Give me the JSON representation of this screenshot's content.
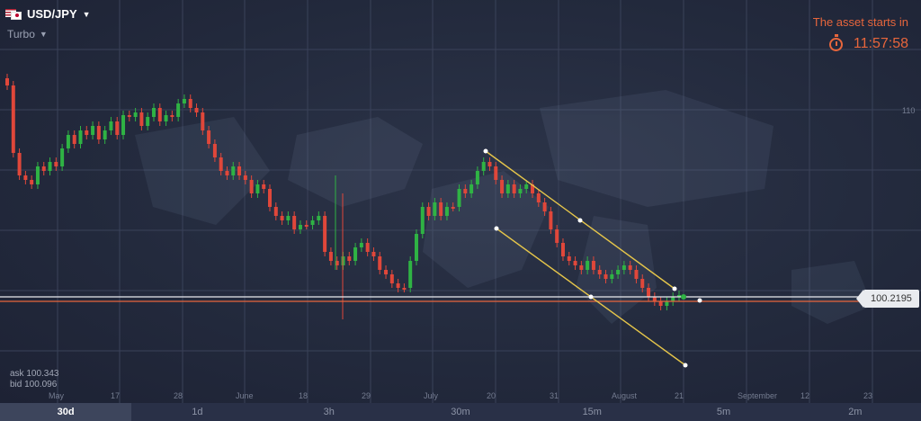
{
  "asset": {
    "name": "USD/JPY",
    "type": "Turbo",
    "flag_icon": "usd-jpy-flag-icon"
  },
  "timer": {
    "label": "The asset starts in",
    "time": "11:57:58",
    "icon": "stopwatch-icon",
    "color": "#e8663c"
  },
  "current_price": "100.2195",
  "quotes": {
    "ask": "ask 100.343",
    "bid": "bid 100.096"
  },
  "y_axis": {
    "tick": "110"
  },
  "x_axis": {
    "labels": [
      "May",
      "17",
      "28",
      "June",
      "18",
      "29",
      "July",
      "20",
      "31",
      "August",
      "21",
      "September",
      "12",
      "23"
    ]
  },
  "timeframes": [
    {
      "label": "30d",
      "active": true
    },
    {
      "label": "1d",
      "active": false
    },
    {
      "label": "3h",
      "active": false
    },
    {
      "label": "30m",
      "active": false
    },
    {
      "label": "15m",
      "active": false
    },
    {
      "label": "5m",
      "active": false
    },
    {
      "label": "2m",
      "active": false
    }
  ],
  "colors": {
    "up": "#2fb344",
    "down": "#e0473a",
    "trend": "#e6c64a",
    "price_line": "#e9ebef",
    "ask_line": "#e8663c"
  }
}
